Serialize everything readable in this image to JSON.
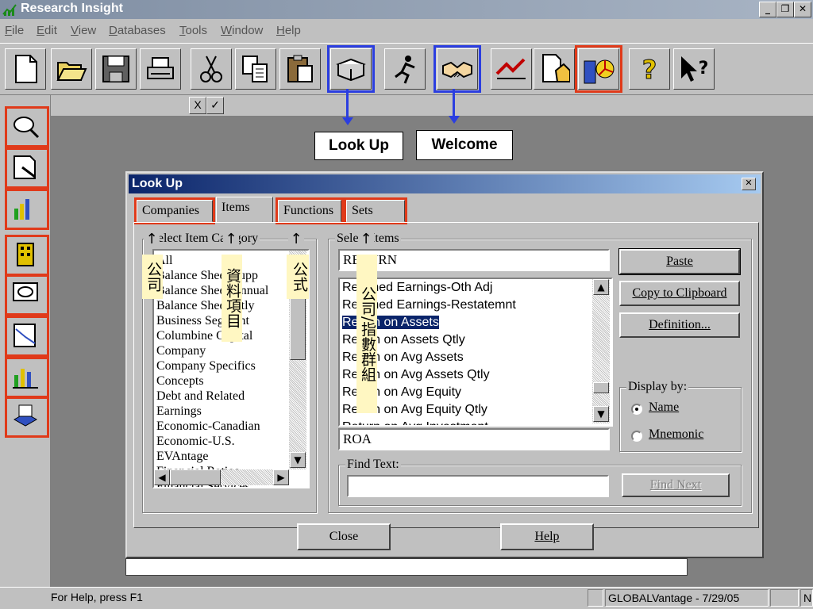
{
  "window": {
    "title": "Research Insight",
    "min_label": "_",
    "max_label": "❐",
    "close_label": "✕"
  },
  "menu": [
    {
      "label": "File",
      "accel": "F",
      "rest": "ile"
    },
    {
      "label": "Edit",
      "accel": "E",
      "rest": "dit"
    },
    {
      "label": "View",
      "accel": "V",
      "rest": "iew"
    },
    {
      "label": "Databases",
      "accel": "D",
      "rest": "atabases"
    },
    {
      "label": "Tools",
      "accel": "T",
      "rest": "ools"
    },
    {
      "label": "Window",
      "accel": "W",
      "rest": "indow"
    },
    {
      "label": "Help",
      "accel": "H",
      "rest": "elp"
    }
  ],
  "toolbar_icons": [
    "new-file-icon",
    "open-folder-icon",
    "save-disk-icon",
    "print-icon",
    "cut-scissors-icon",
    "copy-icon",
    "paste-clipboard-icon",
    "lookup-book-icon",
    "runner-icon",
    "welcome-handshake-icon",
    "chart-speed-icon",
    "report-house-icon",
    "building-chart-icon",
    "help-question-icon",
    "context-help-icon"
  ],
  "formula": {
    "cancel": "X",
    "accept": "✓"
  },
  "callouts": {
    "lookup": "Look Up",
    "welcome": "Welcome"
  },
  "colors": {
    "highlight_blue": "#2b3ee0",
    "highlight_red": "#e03a1a",
    "title_blue": "#0a246a",
    "annotation_bg": "#fff7c2"
  },
  "dialog": {
    "title": "Look Up",
    "close": "✕",
    "tabs": [
      "Companies",
      "Items",
      "Functions",
      "Sets"
    ],
    "category_group": "Select Item Category",
    "categories": [
      "All",
      "Balance Sheet Supp",
      "Balance Sheet Annual",
      "Balance Sheet Qtly",
      "Business Segment",
      "Columbine Capital",
      "Company",
      "Company Specifics",
      "Concepts",
      "Debt and Related",
      "Earnings",
      "Economic-Canadian",
      "Economic-U.S.",
      "EVAntage",
      "Financial Ratios",
      "Financial Services"
    ],
    "items_group": "Select Items",
    "search_value": "RETURN",
    "items": [
      "Retained Earnings-Oth Adj",
      "Retained Earnings-Restatemnt",
      "Return on Assets",
      "Return on Assets Qtly",
      "Return on Avg Assets",
      "Return on Avg Assets Qtly",
      "Return on Avg Equity",
      "Return on Avg Equity Qtly",
      "Return on Avg Investment"
    ],
    "selected_index": 2,
    "mnemonic": "ROA",
    "buttons": {
      "paste": "Paste",
      "copy": "Copy to Clipboard",
      "definition": "Definition..."
    },
    "display_by": "Display by:",
    "radio_name": "Name",
    "radio_mnemonic": "Mnemonic",
    "find_text_label": "Find Text:",
    "find_next": "Find Next",
    "close_btn": "Close",
    "help_btn": "Help"
  },
  "annotations": {
    "arrow": "↑",
    "companies": "公司",
    "items": "資料項目",
    "functions": "公式",
    "sets": "公司/指數群組"
  },
  "status": {
    "help": "For Help, press F1",
    "db": "GLOBALVantage - 7/29/05",
    "num": "NUM"
  }
}
